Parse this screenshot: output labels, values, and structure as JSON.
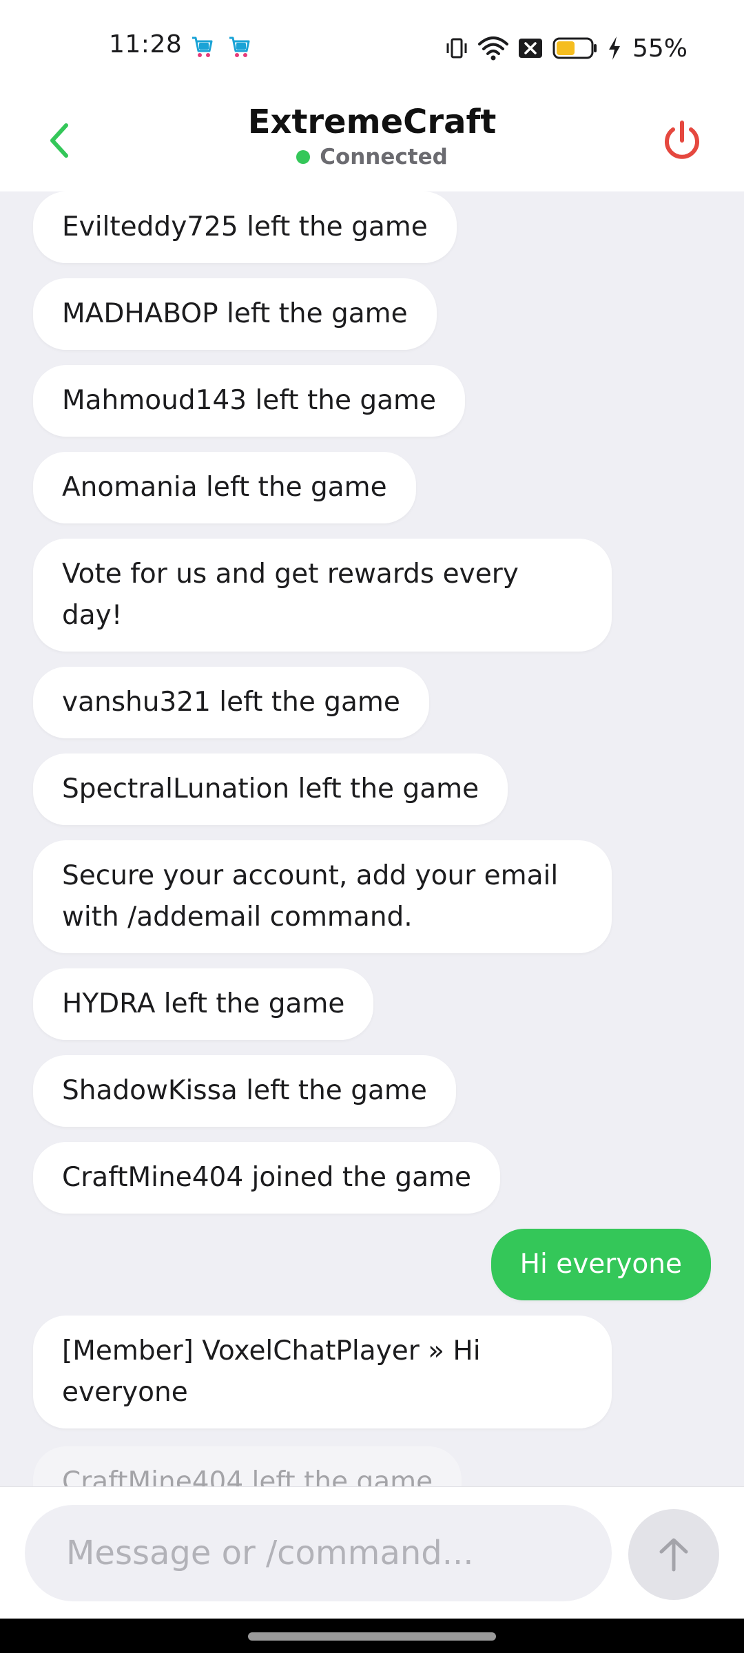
{
  "status_bar": {
    "time": "11:28",
    "battery_percent": "55%",
    "battery_level": 0.55,
    "notification_icons": [
      "shopping-cart-app-icon",
      "shopping-cart-app-icon"
    ],
    "system_icons": [
      "vibrate-icon",
      "wifi-icon",
      "sim-error-icon",
      "battery-icon",
      "charging-bolt-icon"
    ]
  },
  "header": {
    "title": "ExtremeCraft",
    "status_text": "Connected",
    "status_color": "#34c759",
    "back_icon": "chevron-left-icon",
    "disconnect_icon": "power-icon"
  },
  "chat": {
    "messages": [
      {
        "text": "Evilteddy725 left the game",
        "outgoing": false
      },
      {
        "text": "MADHABOP left the game",
        "outgoing": false
      },
      {
        "text": "Mahmoud143 left the game",
        "outgoing": false
      },
      {
        "text": "Anomania left the game",
        "outgoing": false
      },
      {
        "text": "Vote for us and get rewards every day!",
        "outgoing": false
      },
      {
        "text": "vanshu321 left the game",
        "outgoing": false
      },
      {
        "text": "SpectralLunation left the game",
        "outgoing": false
      },
      {
        "text": "Secure your account, add your email with /addemail command.",
        "outgoing": false
      },
      {
        "text": "HYDRA left the game",
        "outgoing": false
      },
      {
        "text": "ShadowKissa left the game",
        "outgoing": false
      },
      {
        "text": "CraftMine404 joined the game",
        "outgoing": false
      },
      {
        "text": "Hi everyone",
        "outgoing": true
      },
      {
        "text": "[Member] VoxelChatPlayer » Hi everyone",
        "outgoing": false
      },
      {
        "text": "CraftMine404 left the game",
        "outgoing": false
      }
    ]
  },
  "composer": {
    "placeholder": "Message or /command...",
    "value": "",
    "send_icon": "arrow-up-icon"
  },
  "colors": {
    "accent": "#34c759",
    "danger": "#e5483f",
    "background": "#efeff4"
  }
}
